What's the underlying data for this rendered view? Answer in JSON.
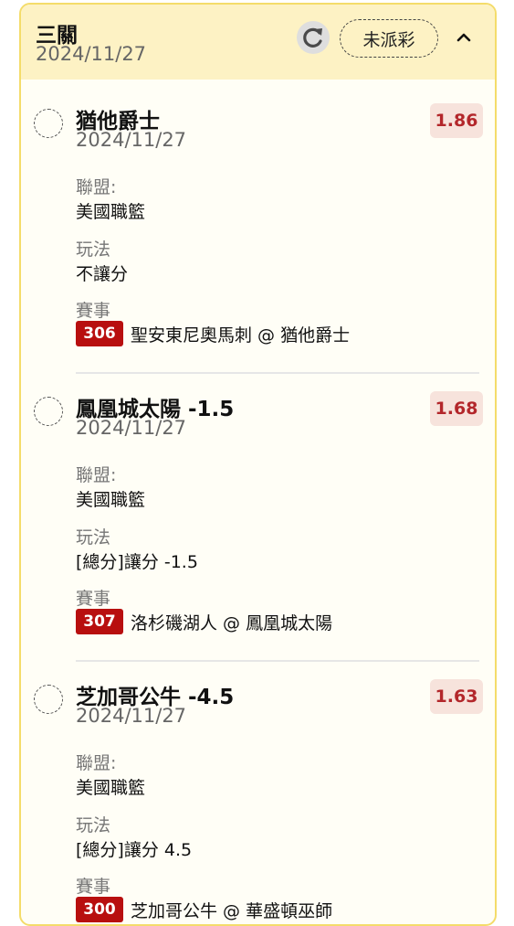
{
  "header": {
    "title": "三關",
    "date": "2024/11/27",
    "status": "未派彩"
  },
  "labels": {
    "league": "聯盟:",
    "bet_type": "玩法",
    "match": "賽事"
  },
  "legs": [
    {
      "name": "猶他爵士",
      "date": "2024/11/27",
      "odds": "1.86",
      "league": "美國職籃",
      "bet_type": "不讓分",
      "match_no": "306",
      "match": "聖安東尼奧馬刺 @ 猶他爵士"
    },
    {
      "name": "鳳凰城太陽 -1.5",
      "date": "2024/11/27",
      "odds": "1.68",
      "league": "美國職籃",
      "bet_type": "[總分]讓分 -1.5",
      "match_no": "307",
      "match": "洛杉磯湖人 @ 鳳凰城太陽"
    },
    {
      "name": "芝加哥公牛 -4.5",
      "date": "2024/11/27",
      "odds": "1.63",
      "league": "美國職籃",
      "bet_type": "[總分]讓分 4.5",
      "match_no": "300",
      "match": "芝加哥公牛 @ 華盛頓巫師"
    }
  ],
  "colors": {
    "border": "#f4dc6a",
    "header_bg": "#fdf2c4",
    "odds_text": "#b3272b",
    "match_badge": "#b80f0f"
  }
}
